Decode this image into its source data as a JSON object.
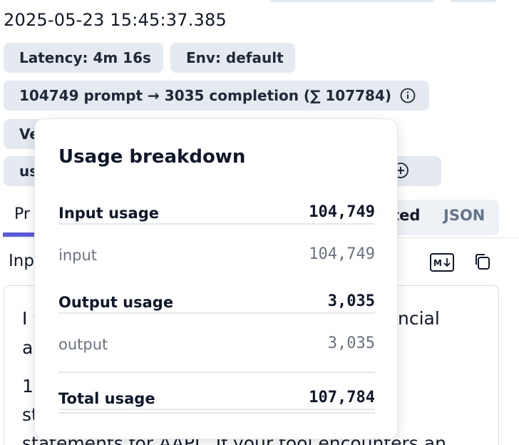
{
  "header": {
    "timestamp": "2025-05-23 15:45:37.385"
  },
  "badges": {
    "latency": "Latency: 4m 16s",
    "env": "Env: default",
    "tokens": "104749 prompt → 3035 completion (∑ 107784)",
    "version_prefix": "Ve",
    "usage_prefix": "us",
    "usage_suffix": ")"
  },
  "tabs": {
    "first_prefix": "Pr",
    "formatted_label": "tted",
    "json_label": "JSON"
  },
  "input_section": {
    "label_prefix": "Inp",
    "lines": [
      "I w",
      "ar",
      "1",
      "st",
      "statements for AAPL. If your tool encounters an"
    ],
    "lines_right": [
      "ncial"
    ]
  },
  "usage_popover": {
    "title": "Usage breakdown",
    "input_usage_label": "Input usage",
    "input_usage_value": "104,749",
    "input_label": "input",
    "input_value": "104,749",
    "output_usage_label": "Output usage",
    "output_usage_value": "3,035",
    "output_label": "output",
    "output_value": "3,035",
    "total_label": "Total usage",
    "total_value": "107,784"
  },
  "colors": {
    "accent": "#5b5bd6",
    "pill_bg": "#e5e9f0"
  }
}
